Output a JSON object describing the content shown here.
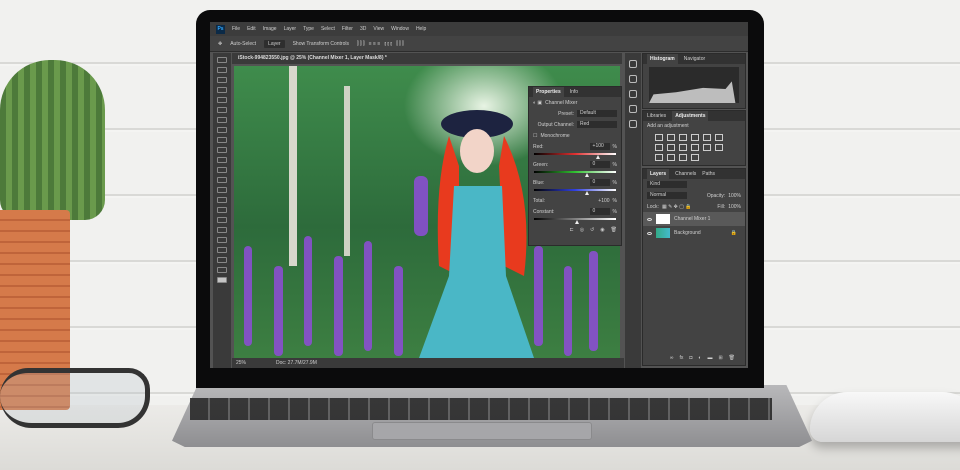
{
  "menu": {
    "app_icon": "Ps",
    "items": [
      "File",
      "Edit",
      "Image",
      "Layer",
      "Type",
      "Select",
      "Filter",
      "3D",
      "View",
      "Window",
      "Help"
    ]
  },
  "options": {
    "auto_select": "Auto-Select",
    "target": "Layer",
    "show_transform": "Show Transform Controls"
  },
  "document": {
    "tab": "iStock-994823550.jpg @ 25% (Channel Mixer 1, Layer Mask/8) *",
    "zoom": "25%",
    "doc_size": "Doc: 27.7M/27.9M"
  },
  "properties": {
    "tabs": [
      "Properties",
      "Info"
    ],
    "title": "Channel Mixer",
    "preset_label": "Preset:",
    "preset": "Default",
    "output_label": "Output Channel:",
    "output": "Red",
    "monochrome": "Monochrome",
    "channels": [
      {
        "label": "Red:",
        "value": "+100",
        "unit": "%",
        "pos": 100,
        "color": "#e03030"
      },
      {
        "label": "Green:",
        "value": "0",
        "unit": "%",
        "pos": 50,
        "color": "#30c030"
      },
      {
        "label": "Blue:",
        "value": "0",
        "unit": "%",
        "pos": 50,
        "color": "#3040e0"
      }
    ],
    "total_label": "Total:",
    "total": "+100",
    "total_unit": "%",
    "constant_label": "Constant:",
    "constant": "0",
    "constant_unit": "%"
  },
  "histogram": {
    "tabs": [
      "Histogram",
      "Navigator"
    ]
  },
  "adjustments": {
    "tabs": [
      "Libraries",
      "Adjustments"
    ],
    "heading": "Add an adjustment"
  },
  "layers": {
    "tabs": [
      "Layers",
      "Channels",
      "Paths"
    ],
    "filter": "Kind",
    "blend": "Normal",
    "opacity_label": "Opacity:",
    "opacity": "100%",
    "lock_label": "Lock:",
    "fill_label": "Fill:",
    "fill": "100%",
    "items": [
      {
        "name": "Channel Mixer 1"
      },
      {
        "name": "Background"
      }
    ]
  }
}
